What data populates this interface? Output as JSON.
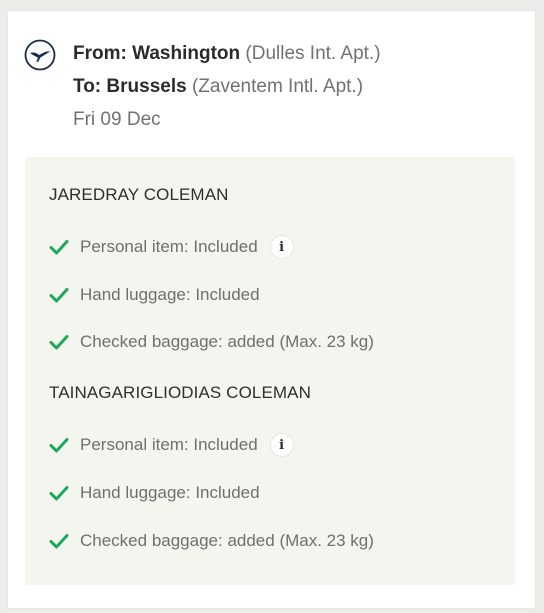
{
  "flight": {
    "from_label": "From: Washington",
    "from_airport": "(Dulles Int. Apt.)",
    "to_label": "To: Brussels",
    "to_airport": "(Zaventem Intl. Apt.)",
    "date": "Fri 09 Dec",
    "logo_icon": "crane-logo-icon"
  },
  "passengers": [
    {
      "name": "JAREDRAY COLEMAN",
      "items": [
        {
          "text": "Personal item: Included",
          "icon": "check-icon",
          "info_icon": "info-icon",
          "info_glyph": "i"
        },
        {
          "text": "Hand luggage: Included",
          "icon": "check-icon"
        },
        {
          "text": "Checked baggage:  added (Max. 23 kg)",
          "icon": "check-icon"
        }
      ]
    },
    {
      "name": "TAINAGARIGLIODIAS COLEMAN",
      "items": [
        {
          "text": "Personal item: Included",
          "icon": "check-icon",
          "info_icon": "info-icon",
          "info_glyph": "i"
        },
        {
          "text": "Hand luggage: Included",
          "icon": "check-icon"
        },
        {
          "text": "Checked baggage:  added (Max. 23 kg)",
          "icon": "check-icon"
        }
      ]
    }
  ],
  "colors": {
    "check": "#1aa85a",
    "panel_bg": "#f4f5ef",
    "text_dark": "#2b2b2b",
    "text_muted": "#717171"
  }
}
